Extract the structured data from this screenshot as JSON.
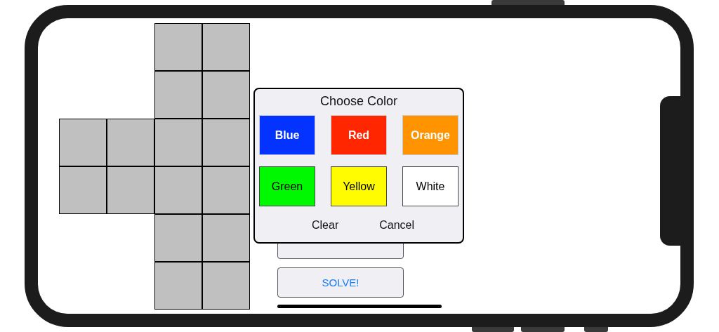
{
  "cube_net": {
    "faces": [
      {
        "kind": "up",
        "stickers": [
          {
            "color": "#c0c0c0"
          },
          {
            "color": "#c0c0c0"
          },
          {
            "color": "#c0c0c0"
          },
          {
            "color": "#c0c0c0"
          }
        ]
      },
      {
        "kind": "left",
        "stickers": [
          {
            "color": "#c0c0c0"
          },
          {
            "color": "#c0c0c0"
          },
          {
            "color": "#c0c0c0"
          },
          {
            "color": "#c0c0c0"
          }
        ]
      },
      {
        "kind": "front",
        "stickers": [
          {
            "color": "#c0c0c0"
          },
          {
            "color": "#c0c0c0"
          },
          {
            "color": "#c0c0c0"
          },
          {
            "color": "#c0c0c0"
          }
        ]
      },
      {
        "kind": "down",
        "stickers": [
          {
            "color": "#c0c0c0"
          },
          {
            "color": "#c0c0c0"
          },
          {
            "color": "#c0c0c0"
          },
          {
            "color": "#c0c0c0"
          }
        ]
      }
    ]
  },
  "buttons": [
    {
      "label": "SOLVE!"
    }
  ],
  "color_dialog": {
    "title": "Choose Color",
    "colors": [
      {
        "label": "Blue",
        "color": "#0433ff"
      },
      {
        "label": "Red",
        "color": "#ff2600"
      },
      {
        "label": "Orange",
        "color": "#ff9300"
      },
      {
        "label": "Green",
        "color": "#00f900"
      },
      {
        "label": "Yellow",
        "color": "#fffb00"
      },
      {
        "label": "White",
        "color": "#ffffff"
      }
    ],
    "actions": [
      {
        "label": "Clear"
      },
      {
        "label": "Cancel"
      }
    ]
  }
}
